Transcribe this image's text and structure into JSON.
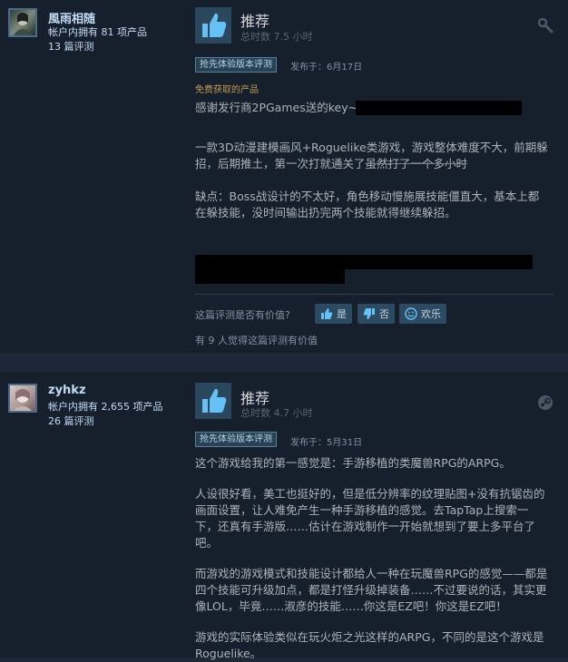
{
  "reviews": [
    {
      "author": "風雨相随",
      "owned": "帐户内拥有 81 项产品",
      "review_count": "13 篇评测",
      "verdict": "推荐",
      "hours": "总时数 7.5 小时",
      "badge": "抢先体验版本评测",
      "posted": "发布于：6月17日",
      "free_label": "免费获取的产品",
      "line1": "感谢发行商2PGames送的key~",
      "para2_a": "一款3D动漫建模画风+Roguelike类游戏，游戏整体难度不大，前期躲招，后期推土，第一次打就通关了",
      "para2_b": "虽然打了一个多小时",
      "para3": "缺点：Boss战设计的不太好，角色移动慢施展技能僵直大，基本上都在躲技能，没时间输出扔完两个技能就得继续躲招。",
      "helpful_question": "这篇评测是否有价值?",
      "yes": "是",
      "no": "否",
      "funny": "欢乐",
      "helpful_count": "有 9 人觉得这篇评测有价值",
      "icon": "gear-icon"
    },
    {
      "author": "zyhkz",
      "owned": "帐户内拥有 2,655 项产品",
      "review_count": "26 篇评测",
      "verdict": "推荐",
      "hours": "总时数 4.7 小时",
      "badge": "抢先体验版本评测",
      "posted": "发布于：5月31日",
      "p1": "这个游戏给我的第一感觉是：手游移植的类魔兽RPG的ARPG。",
      "p2": "人设很好看，美工也挺好的，但是低分辨率的纹理贴图+没有抗锯齿的画面设置，让人难免产生一种手游移植的感觉。去TapTap上搜索一下，还真有手游版……估计在游戏制作一开始就想到了要上多平台了吧。",
      "p3": "而游戏的游戏模式和技能设计都给人一种在玩魔兽RPG的感觉——都是四个技能可升级加点，都是打怪升级掉装备……不过要说的话，其实更像LOL，毕竟……淑彦的技能……你这是EZ吧！你这是EZ吧！",
      "p4": "游戏的实际体验类似在玩火炬之光这样的ARPG，不同的是这个游戏是Roguelike。",
      "icon": "steam-icon"
    }
  ],
  "colors": {
    "accent": "#67c1f5",
    "thumb_bg": "#2a475e",
    "free": "#c29a52"
  }
}
